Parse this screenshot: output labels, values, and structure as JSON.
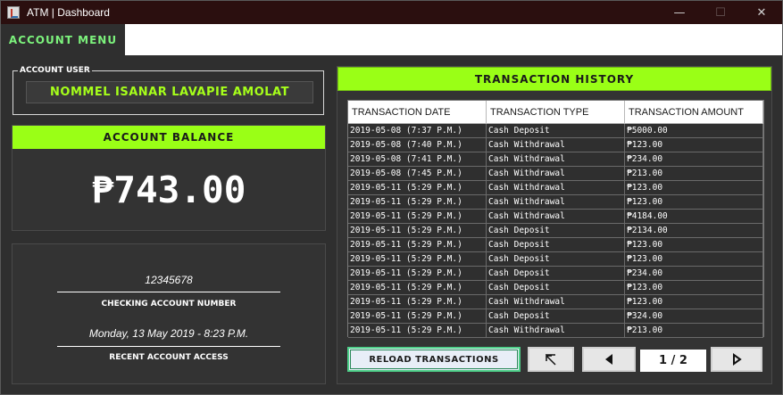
{
  "window": {
    "title": "ATM | Dashboard",
    "minimize": "—",
    "maximize": "☐",
    "close": "✕"
  },
  "menu": {
    "tab": "ACCOUNT MENU"
  },
  "user": {
    "legend": "ACCOUNT USER",
    "name": "NOMMEL ISANAR LAVAPIE AMOLAT"
  },
  "balance": {
    "header": "ACCOUNT BALANCE",
    "amount": "₱743.00"
  },
  "account": {
    "number": "12345678",
    "number_label": "CHECKING ACCOUNT NUMBER",
    "access_date": "Monday, 13 May 2019 - 8:23 P.M.",
    "access_label": "RECENT ACCOUNT ACCESS"
  },
  "history": {
    "header": "TRANSACTION HISTORY",
    "columns": [
      "TRANSACTION DATE",
      "TRANSACTION TYPE",
      "TRANSACTION AMOUNT"
    ],
    "rows": [
      [
        "2019-05-08 (7:37 P.M.)",
        "Cash Deposit",
        "₱5000.00"
      ],
      [
        "2019-05-08 (7:40 P.M.)",
        "Cash Withdrawal",
        "₱123.00"
      ],
      [
        "2019-05-08 (7:41 P.M.)",
        "Cash Withdrawal",
        "₱234.00"
      ],
      [
        "2019-05-08 (7:45 P.M.)",
        "Cash Withdrawal",
        "₱213.00"
      ],
      [
        "2019-05-11 (5:29 P.M.)",
        "Cash Withdrawal",
        "₱123.00"
      ],
      [
        "2019-05-11 (5:29 P.M.)",
        "Cash Withdrawal",
        "₱123.00"
      ],
      [
        "2019-05-11 (5:29 P.M.)",
        "Cash Withdrawal",
        "₱4184.00"
      ],
      [
        "2019-05-11 (5:29 P.M.)",
        "Cash Deposit",
        "₱2134.00"
      ],
      [
        "2019-05-11 (5:29 P.M.)",
        "Cash Deposit",
        "₱123.00"
      ],
      [
        "2019-05-11 (5:29 P.M.)",
        "Cash Deposit",
        "₱123.00"
      ],
      [
        "2019-05-11 (5:29 P.M.)",
        "Cash Deposit",
        "₱234.00"
      ],
      [
        "2019-05-11 (5:29 P.M.)",
        "Cash Deposit",
        "₱123.00"
      ],
      [
        "2019-05-11 (5:29 P.M.)",
        "Cash Withdrawal",
        "₱123.00"
      ],
      [
        "2019-05-11 (5:29 P.M.)",
        "Cash Deposit",
        "₱324.00"
      ],
      [
        "2019-05-11 (5:29 P.M.)",
        "Cash Withdrawal",
        "₱213.00"
      ]
    ],
    "reload_label": "RELOAD TRANSACTIONS",
    "page": "1 / 2",
    "icons": {
      "first": "first-page-icon",
      "prev": "prev-arrow-icon",
      "next": "next-arrow-icon"
    }
  },
  "colors": {
    "accent": "#9aff16",
    "user_name": "#a6ff1a",
    "menu_tab_text": "#7cf27c",
    "titlebar": "#2b0f0f",
    "panel": "#2f2f2f"
  }
}
